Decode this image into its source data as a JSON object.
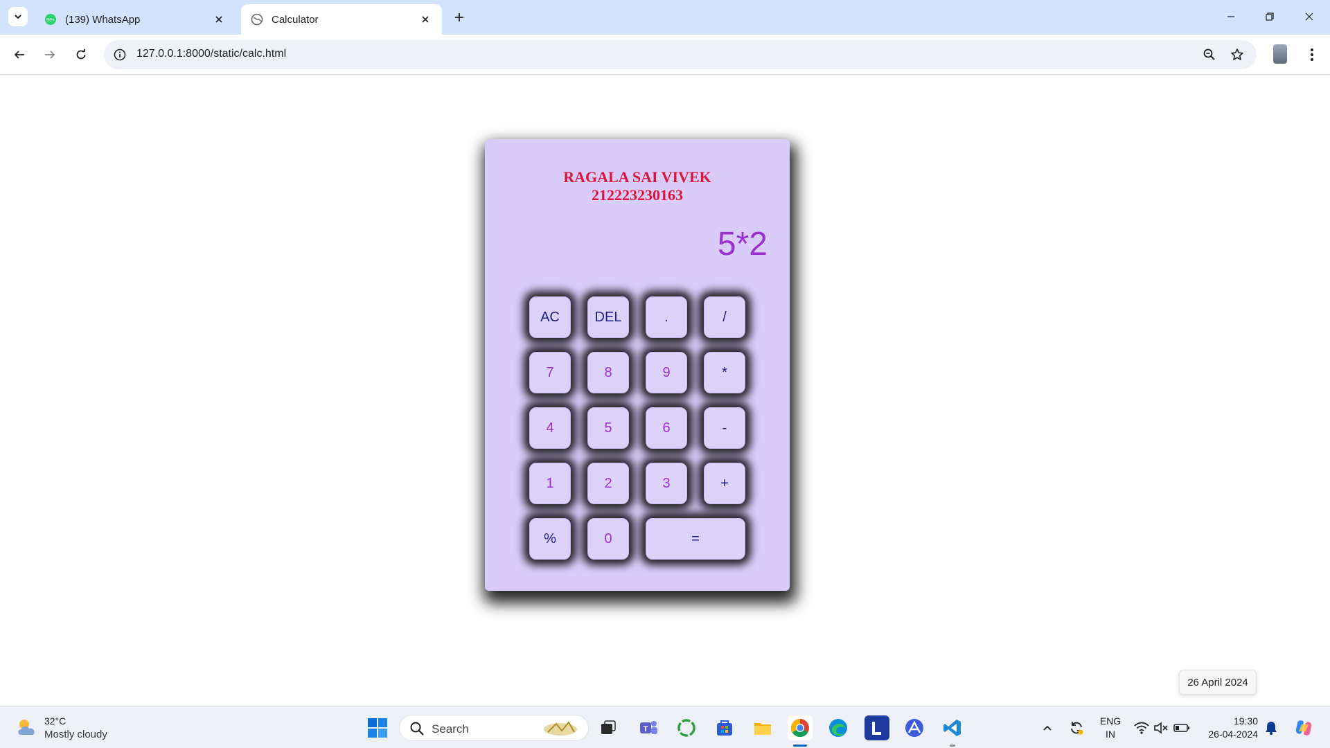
{
  "browser": {
    "tabs": [
      {
        "title": "(139) WhatsApp",
        "badge": "99+",
        "active": false
      },
      {
        "title": "Calculator",
        "active": true
      }
    ],
    "url": "127.0.0.1:8000/static/calc.html"
  },
  "calculator": {
    "name": "RAGALA SAI VIVEK",
    "id": "212223230163",
    "display": "5*2",
    "keys": [
      "AC",
      "DEL",
      ".",
      "/",
      "7",
      "8",
      "9",
      "*",
      "4",
      "5",
      "6",
      "-",
      "1",
      "2",
      "3",
      "+",
      "%",
      "0",
      "="
    ],
    "colors": {
      "panel": "#d9ccf9",
      "digit_text": "#9932cc",
      "operator_text": "#1e1e80",
      "header_text": "#dc143c"
    }
  },
  "tooltip": {
    "date": "26 April 2024"
  },
  "taskbar": {
    "weather": {
      "temp": "32°C",
      "desc": "Mostly cloudy"
    },
    "search_label": "Search",
    "language": {
      "line1": "ENG",
      "line2": "IN"
    },
    "clock": {
      "time": "19:30",
      "date": "26-04-2024"
    },
    "pinned_icons": [
      "windows-start-icon",
      "task-view-icon",
      "teams-icon",
      "circle-app-icon",
      "store-icon",
      "file-explorer-icon",
      "chrome-icon",
      "edge-icon",
      "l-app-icon",
      "arc-app-icon",
      "vscode-icon"
    ]
  }
}
